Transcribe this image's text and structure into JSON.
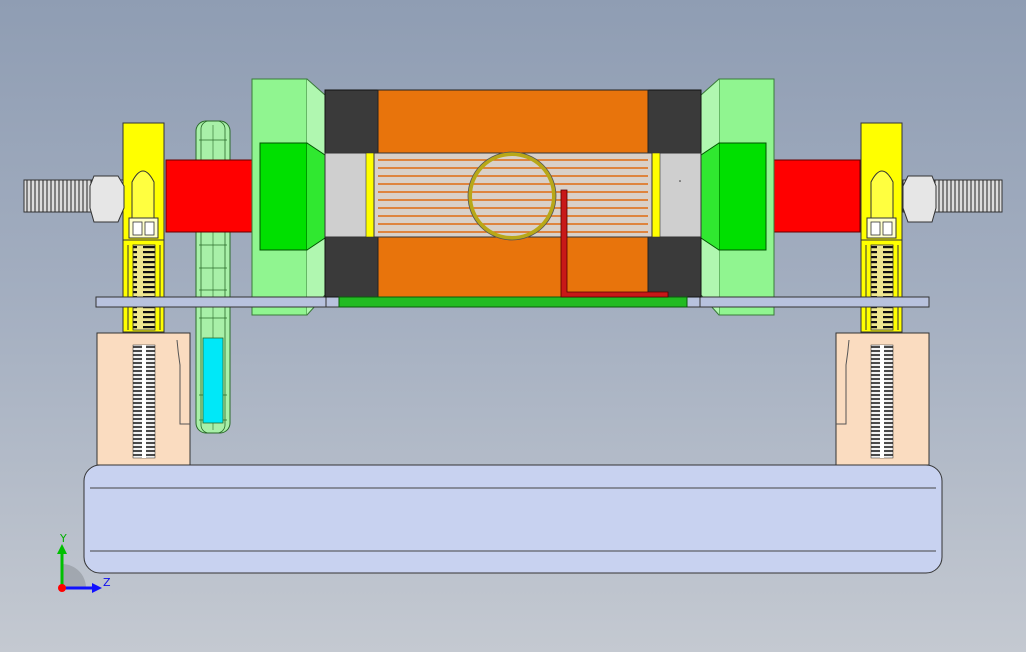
{
  "viewport": {
    "background_top": "#8f9db3",
    "background_bottom": "#c4c9d1"
  },
  "model_colors": {
    "motor_housing": "#e8740c",
    "motor_stator_end": "#3a3a3a",
    "bearing_block": "#90f590",
    "hub": "#00e000",
    "shaft_coupling": "#ff0000",
    "bracket": "#ffff00",
    "base_mount": "#fadcc0",
    "base_rail": "#c8d2f0",
    "sprocket_chain": "#a8f0a8",
    "chain_highlight": "#00e8f8",
    "mount_plate": "#b8c2de",
    "green_strip": "#22bb22",
    "l_bracket": "#c81818",
    "ring": "#b8a818",
    "threaded_rod": "#d8d8d8"
  },
  "triad": {
    "y_label": "Y",
    "z_label": "Z",
    "y_axis_color": "#00c000",
    "z_axis_color": "#1010ff",
    "x_axis_color": "#ff0000"
  }
}
